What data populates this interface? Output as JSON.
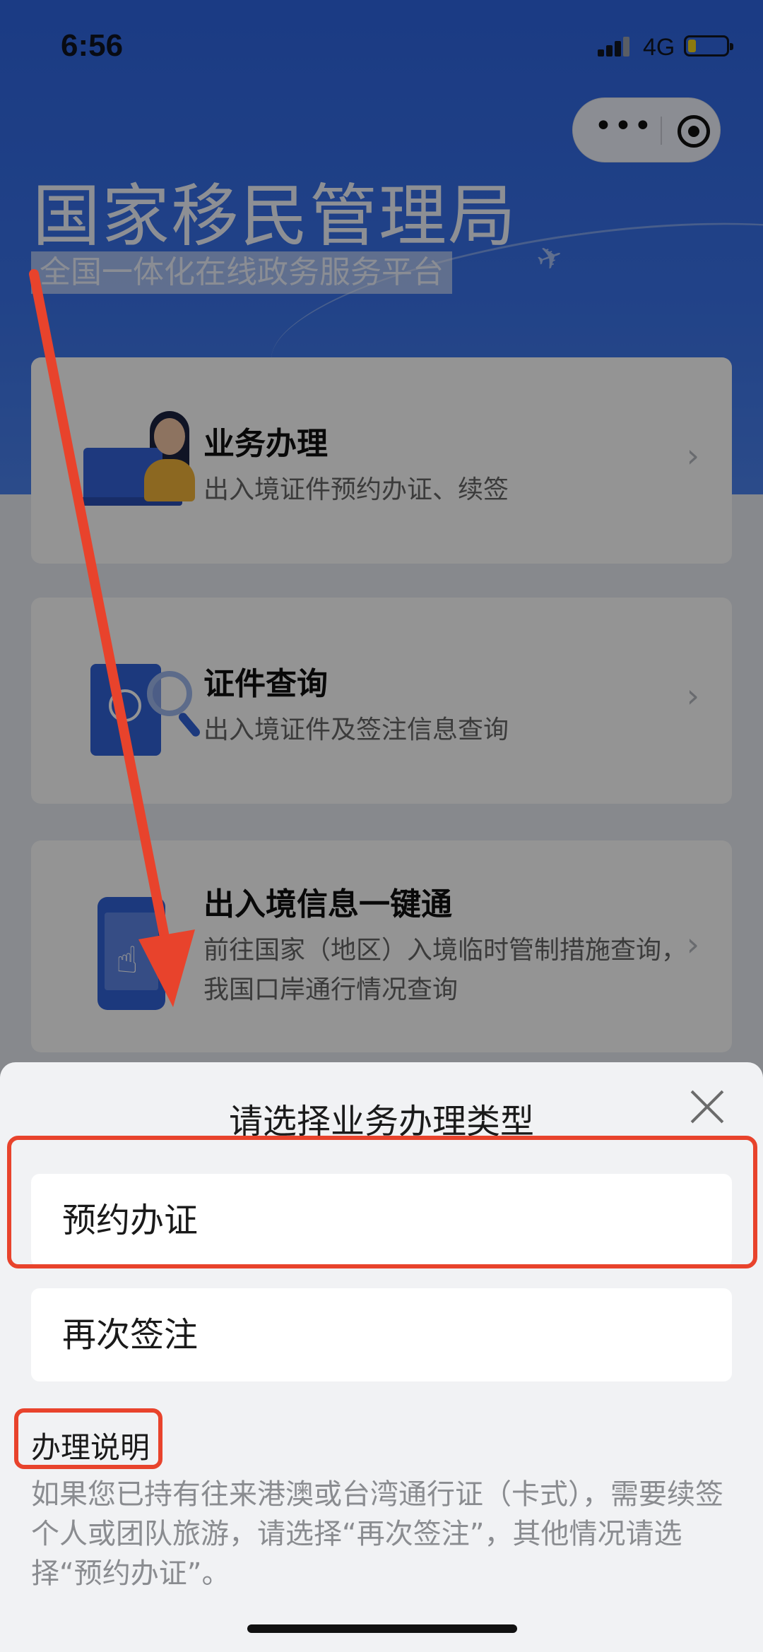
{
  "status_bar": {
    "time": "6:56",
    "network": "4G"
  },
  "capsule": {
    "more": "•••"
  },
  "hero": {
    "title": "国家移民管理局",
    "subtitle": "全国一体化在线政务服务平台"
  },
  "cards": [
    {
      "title": "业务办理",
      "desc": "出入境证件预约办证、续签",
      "chevron": "›"
    },
    {
      "title": "证件查询",
      "desc": "出入境证件及签注信息查询",
      "chevron": "›"
    },
    {
      "title": "出入境信息一键通",
      "desc": "前往国家（地区）入境临时管制措施查询，我国口岸通行情况查询",
      "chevron": "›"
    }
  ],
  "sheet": {
    "title": "请选择业务办理类型",
    "options": [
      "预约办证",
      "再次签注"
    ],
    "note_title": "办理说明",
    "note_text": "如果您已持有往来港澳或台湾通行证（卡式），需要续签个人或团队旅游，请选择“再次签注”，其他情况请选择“预约办证”。"
  },
  "colors": {
    "brand_blue": "#3162d8",
    "annotation_red": "#e8432c"
  },
  "icons": [
    "more-icon",
    "target-icon",
    "close-icon",
    "chevron-right-icon",
    "service-person-icon",
    "passport-search-icon",
    "phone-touch-icon",
    "signal-icon",
    "battery-icon"
  ]
}
